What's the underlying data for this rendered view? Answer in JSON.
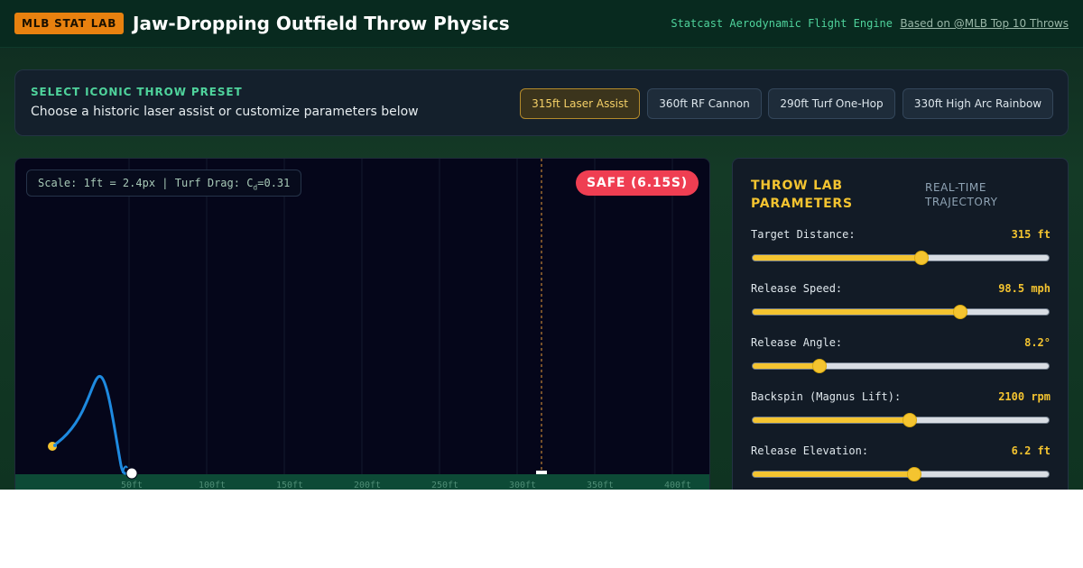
{
  "header": {
    "badge": "MLB STAT LAB",
    "title": "Jaw-Dropping Outfield Throw Physics",
    "engine": "Statcast Aerodynamic Flight Engine",
    "source_link": "Based on @MLB Top 10 Throws"
  },
  "presets": {
    "heading": "SELECT ICONIC THROW PRESET",
    "subtitle": "Choose a historic laser assist or customize parameters below",
    "buttons": [
      {
        "label": "315ft Laser Assist",
        "active": true
      },
      {
        "label": "360ft RF Cannon",
        "active": false
      },
      {
        "label": "290ft Turf One-Hop",
        "active": false
      },
      {
        "label": "330ft High Arc Rainbow",
        "active": false
      }
    ]
  },
  "field": {
    "scale_prefix": "Scale: 1ft = 2.4px | Turf Drag: C",
    "scale_sub": "d",
    "scale_suffix": "=0.31",
    "status": "SAFE (6.15S)",
    "ticks": [
      "50ft",
      "100ft",
      "150ft",
      "200ft",
      "250ft",
      "300ft",
      "350ft",
      "400ft"
    ],
    "colors": {
      "trajectory": "#1e8ae0",
      "release_point": "#f4c430",
      "safe": "#ef3e52",
      "turf": "#0d4a36"
    }
  },
  "params": {
    "title": "THROW LAB PARAMETERS",
    "side_label": "REAL-TIME TRAJECTORY",
    "rows": [
      {
        "name": "distance",
        "label": "Target Distance:",
        "value": "315 ft",
        "fraction": 0.57
      },
      {
        "name": "speed",
        "label": "Release Speed:",
        "value": "98.5 mph",
        "fraction": 0.7
      },
      {
        "name": "angle",
        "label": "Release Angle:",
        "value": "8.2°",
        "fraction": 0.23
      },
      {
        "name": "backspin",
        "label": "Backspin (Magnus Lift):",
        "value": "2100 rpm",
        "fraction": 0.53
      },
      {
        "name": "elevation",
        "label": "Release Elevation:",
        "value": "6.2 ft",
        "fraction": 0.545
      }
    ]
  }
}
